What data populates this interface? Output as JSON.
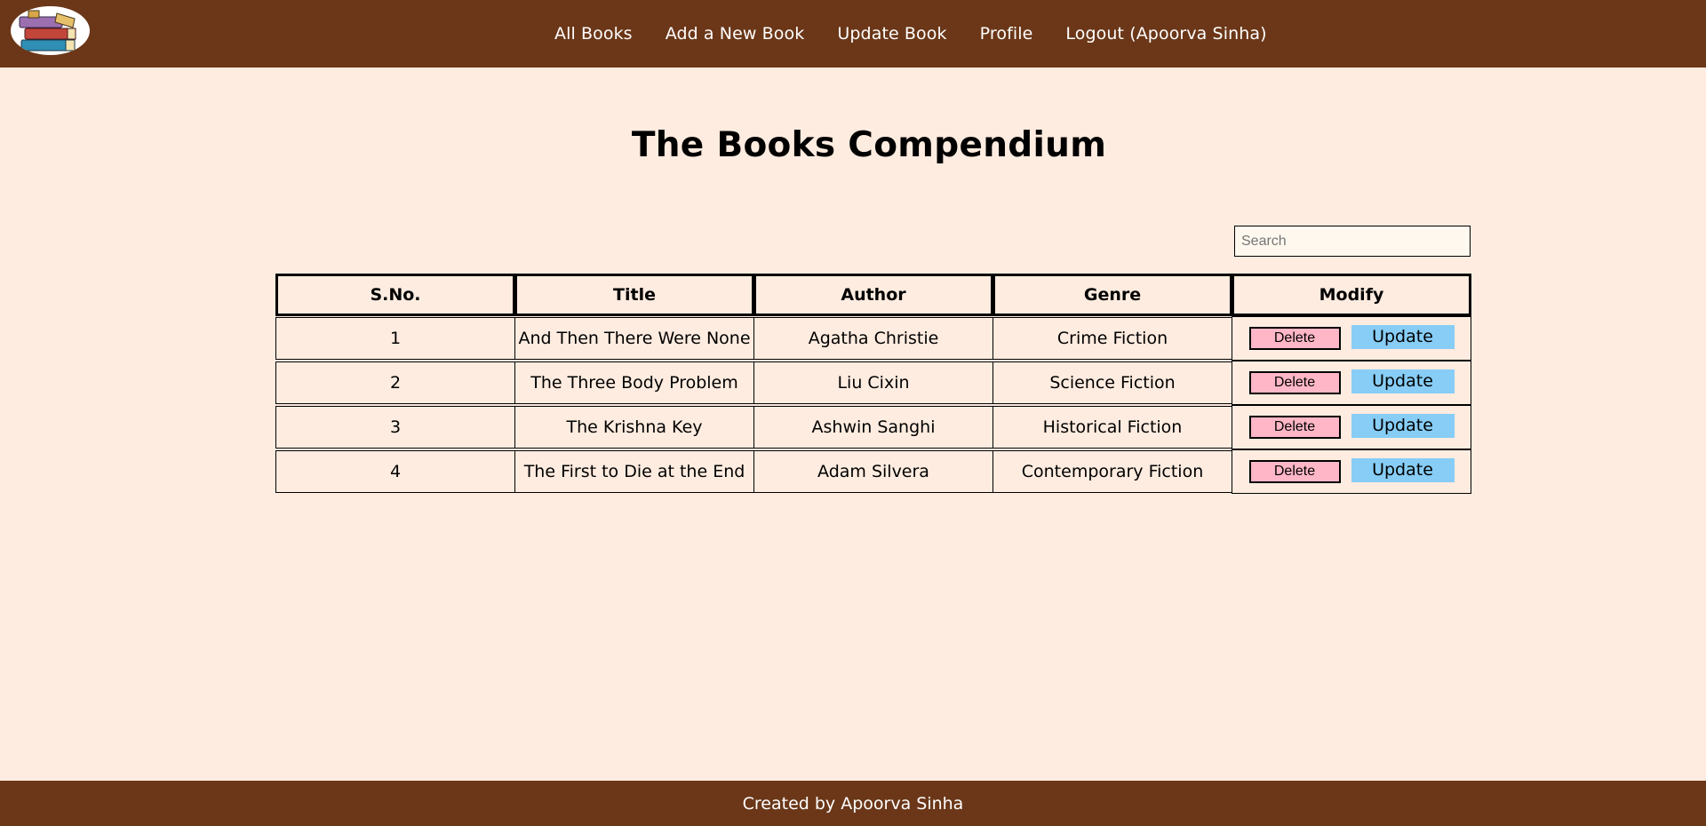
{
  "nav": {
    "logo_icon": "books-stack-icon",
    "links": [
      "All Books",
      "Add a New Book",
      "Update Book",
      "Profile",
      "Logout (Apoorva Sinha)"
    ]
  },
  "page": {
    "title": "The Books Compendium"
  },
  "search": {
    "placeholder": "Search",
    "value": ""
  },
  "table": {
    "headers": [
      "S.No.",
      "Title",
      "Author",
      "Genre",
      "Modify"
    ],
    "rows": [
      {
        "sno": "1",
        "title": "And Then There Were None",
        "author": "Agatha Christie",
        "genre": "Crime Fiction"
      },
      {
        "sno": "2",
        "title": "The Three Body Problem",
        "author": "Liu Cixin",
        "genre": "Science Fiction"
      },
      {
        "sno": "3",
        "title": "The Krishna Key",
        "author": "Ashwin Sanghi",
        "genre": "Historical Fiction"
      },
      {
        "sno": "4",
        "title": "The First to Die at the End",
        "author": "Adam Silvera",
        "genre": "Contemporary Fiction"
      }
    ],
    "delete_label": "Delete",
    "update_label": "Update"
  },
  "footer": {
    "text": "Created by Apoorva Sinha"
  },
  "colors": {
    "nav_bg": "#6b3718",
    "page_bg": "#ffece0",
    "delete_btn": "#ffb6c6",
    "update_btn": "#87cdf6"
  }
}
